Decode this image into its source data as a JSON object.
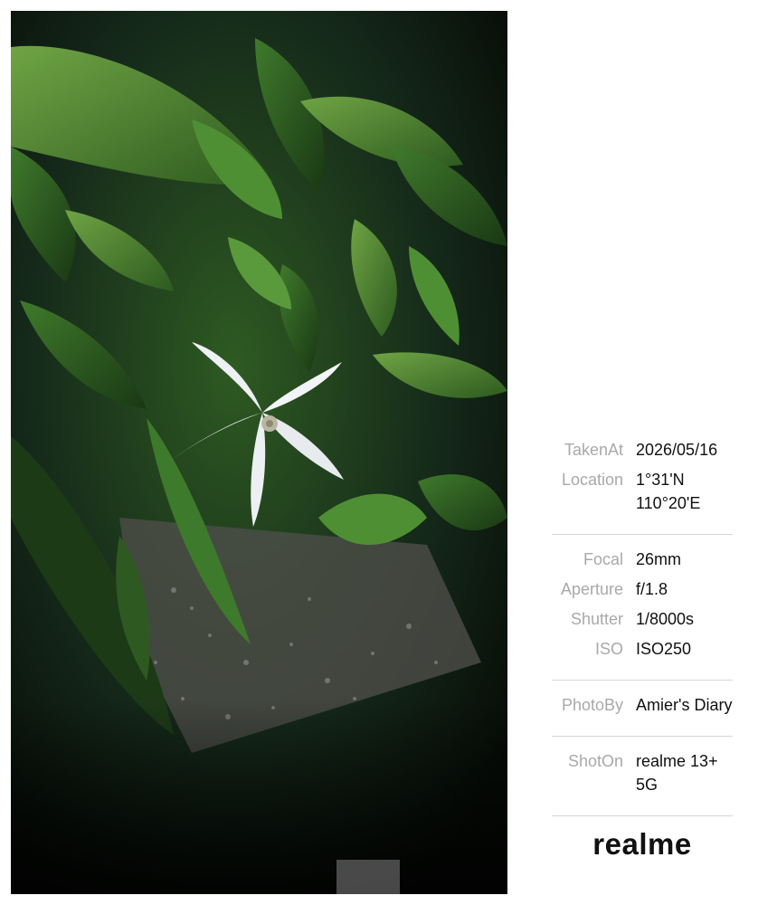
{
  "photo": {
    "subject": "white-star-flower",
    "colors": {
      "petal": "#f2f4f6",
      "leaf": "#3f7a2c",
      "leaf_light": "#6fa444",
      "shadow": "#0b120a",
      "soil": "#8a8a86"
    }
  },
  "exif": {
    "taken_at_label": "TakenAt",
    "taken_at_value": "2026/05/16",
    "location_label": "Location",
    "location_value": "1°31'N\n110°20'E",
    "focal_label": "Focal",
    "focal_value": "26mm",
    "aperture_label": "Aperture",
    "aperture_value": "f/1.8",
    "shutter_label": "Shutter",
    "shutter_value": "1/8000s",
    "iso_label": "ISO",
    "iso_value": "ISO250",
    "photo_by_label": "PhotoBy",
    "photo_by_value": "Amier's Diary",
    "shot_on_label": "ShotOn",
    "shot_on_value": "realme 13+\n5G"
  },
  "brand": {
    "logo_text": "realme"
  }
}
